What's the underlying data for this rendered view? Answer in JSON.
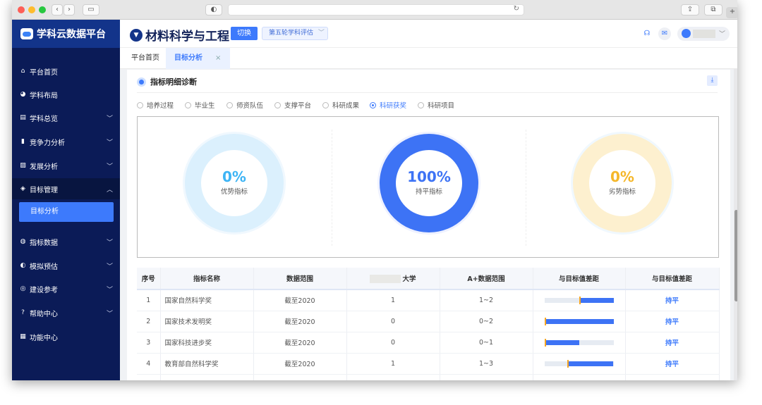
{
  "browser": {
    "reader_icon": "◐",
    "reload_icon": "↻",
    "share_icon": "⇪",
    "tabs_icon": "⧉",
    "new_tab_icon": "+"
  },
  "sidebar": {
    "brand": "学科云数据平台",
    "items": [
      {
        "label": "平台首页",
        "icon": "⌂",
        "chev": ""
      },
      {
        "label": "学科布局",
        "icon": "◕",
        "chev": ""
      },
      {
        "label": "学科总览",
        "icon": "▤",
        "chev": "﹀"
      },
      {
        "label": "竞争力分析",
        "icon": "▮",
        "chev": "﹀"
      },
      {
        "label": "发展分析",
        "icon": "▨",
        "chev": "﹀"
      },
      {
        "label": "目标管理",
        "icon": "◈",
        "chev": "︿"
      },
      {
        "label": "指标数据",
        "icon": "◍",
        "chev": "﹀"
      },
      {
        "label": "模拟预估",
        "icon": "◐",
        "chev": "﹀"
      },
      {
        "label": "建设参考",
        "icon": "◎",
        "chev": "﹀"
      },
      {
        "label": "帮助中心",
        "icon": "?",
        "chev": "﹀"
      },
      {
        "label": "功能中心",
        "icon": "▦",
        "chev": ""
      }
    ],
    "sub_active": "目标分析"
  },
  "header": {
    "title": "材料科学与工程",
    "switch": "切换",
    "round": "第五轮学科评估"
  },
  "tabs": [
    {
      "label": "平台首页"
    },
    {
      "label": "目标分析",
      "close": "×"
    }
  ],
  "section": {
    "title": "指标明细诊断",
    "download_icon": "⤓"
  },
  "radios": [
    "培养过程",
    "毕业生",
    "师资队伍",
    "支撑平台",
    "科研成果",
    "科研获奖",
    "科研项目"
  ],
  "selected_radio": "科研获奖",
  "summary": [
    {
      "pct": "0%",
      "label": "优势指标",
      "value": 0,
      "color": "#3db4f5",
      "ring": "#dbf0fd"
    },
    {
      "pct": "100%",
      "label": "持平指标",
      "value": 100,
      "color": "#3d73f5",
      "ring": "#3d73f5"
    },
    {
      "pct": "0%",
      "label": "劣势指标",
      "value": 0,
      "color": "#f5b72a",
      "ring": "#fdf0cf"
    }
  ],
  "table": {
    "headers": [
      "序号",
      "指标名称",
      "数据范围",
      "大学",
      "A+数据范围",
      "与目标值差距",
      "与目标值差距"
    ],
    "rows": [
      {
        "no": "1",
        "name": "国家自然科学奖",
        "range": "截至2020",
        "value": "1",
        "aplus": "1~2",
        "marker": 0.5,
        "fill_from": 0.5,
        "fill_to": 1,
        "status": "持平"
      },
      {
        "no": "2",
        "name": "国家技术发明奖",
        "range": "截至2020",
        "value": "0",
        "aplus": "0~2",
        "marker": 0,
        "fill_from": 0,
        "fill_to": 1,
        "status": "持平"
      },
      {
        "no": "3",
        "name": "国家科技进步奖",
        "range": "截至2020",
        "value": "0",
        "aplus": "0~1",
        "marker": 0,
        "fill_from": 0,
        "fill_to": 0.5,
        "status": "持平"
      },
      {
        "no": "4",
        "name": "教育部自然科学奖",
        "range": "截至2020",
        "value": "1",
        "aplus": "1~3",
        "marker": 0.33,
        "fill_from": 0.33,
        "fill_to": 1,
        "status": "持平"
      }
    ]
  }
}
